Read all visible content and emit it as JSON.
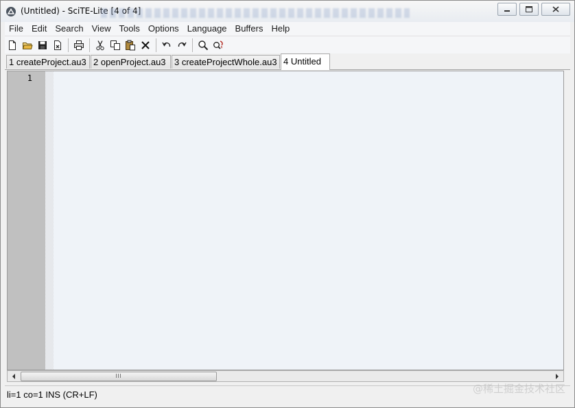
{
  "window": {
    "title": "(Untitled) - SciTE-Lite [4 of 4]"
  },
  "menu": [
    "File",
    "Edit",
    "Search",
    "View",
    "Tools",
    "Options",
    "Language",
    "Buffers",
    "Help"
  ],
  "toolbar": {
    "icons": [
      "new-file-icon",
      "open-folder-icon",
      "save-icon",
      "close-file-icon",
      "print-icon",
      "cut-icon",
      "copy-icon",
      "paste-icon",
      "delete-icon",
      "undo-icon",
      "redo-icon",
      "find-icon",
      "replace-icon"
    ]
  },
  "tabs": [
    {
      "label": "1 createProject.au3",
      "active": false
    },
    {
      "label": "2 openProject.au3",
      "active": false
    },
    {
      "label": "3 createProjectWhole.au3",
      "active": false
    },
    {
      "label": "4 Untitled",
      "active": true
    }
  ],
  "editor": {
    "line_numbers": [
      "1"
    ],
    "content": ""
  },
  "status": {
    "text": "li=1 co=1 INS (CR+LF)"
  },
  "watermark": "@稀土掘金技术社区"
}
